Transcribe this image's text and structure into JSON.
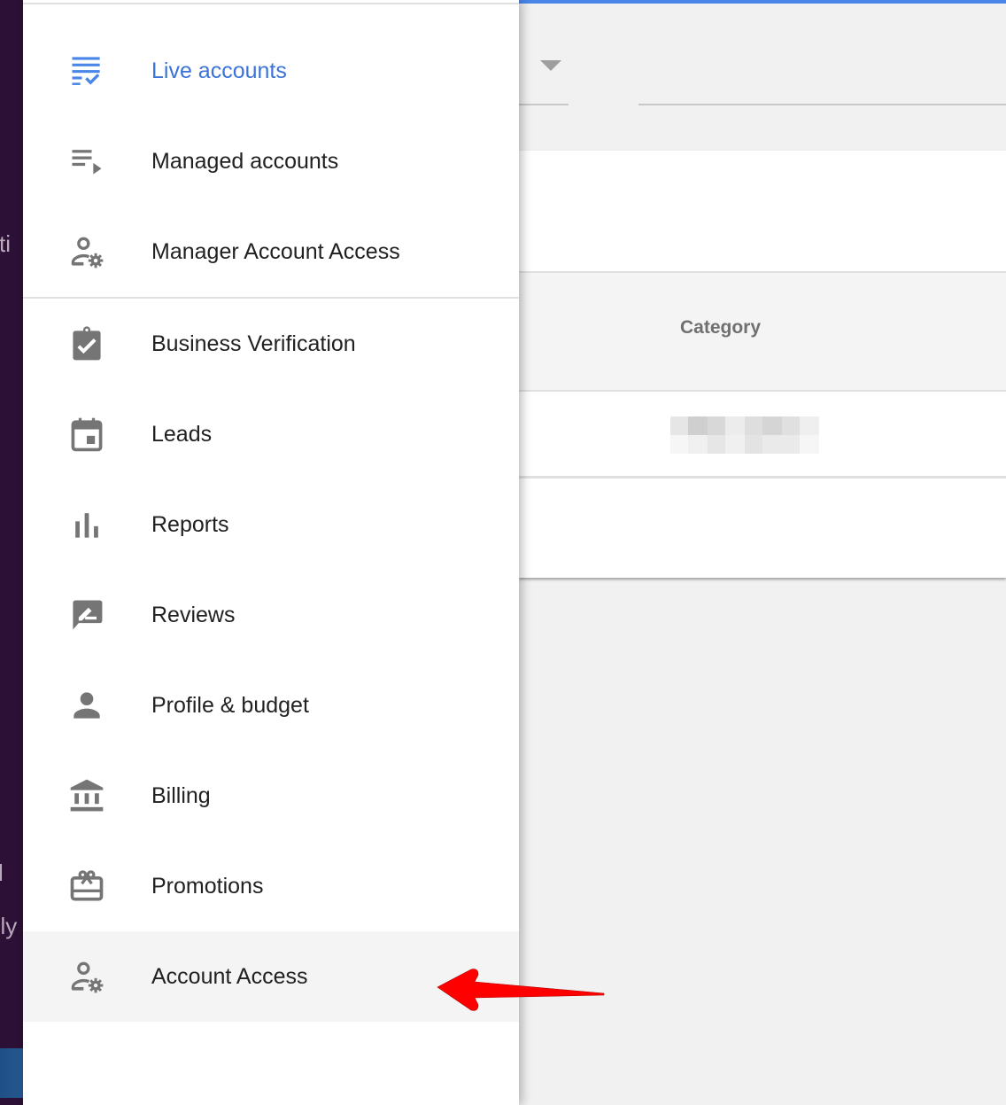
{
  "background_app": {
    "fragments": [
      "sti",
      "l",
      "ely"
    ]
  },
  "main": {
    "table": {
      "columns": [
        "Category"
      ],
      "rows": [
        [
          "[redacted]"
        ]
      ]
    }
  },
  "drawer": {
    "items": [
      {
        "label": "Live accounts",
        "icon": "live-accounts-icon",
        "selected": true
      },
      {
        "label": "Managed accounts",
        "icon": "playlist-play-icon"
      },
      {
        "label": "Manager Account Access",
        "icon": "person-gear-icon"
      },
      {
        "label": "Business Verification",
        "icon": "clipboard-check-icon"
      },
      {
        "label": "Leads",
        "icon": "calendar-icon"
      },
      {
        "label": "Reports",
        "icon": "bar-chart-icon"
      },
      {
        "label": "Reviews",
        "icon": "rate-review-icon"
      },
      {
        "label": "Profile & budget",
        "icon": "person-icon"
      },
      {
        "label": "Billing",
        "icon": "bank-icon"
      },
      {
        "label": "Promotions",
        "icon": "gift-card-icon"
      },
      {
        "label": "Account Access",
        "icon": "person-gear-icon",
        "highlighted": true
      }
    ]
  },
  "colors": {
    "accent": "#3b73d8",
    "icon": "#757575",
    "annotation": "#ff0000",
    "app_strip": "#2d1035"
  },
  "annotation": {
    "type": "arrow",
    "points_to": "Account Access"
  }
}
